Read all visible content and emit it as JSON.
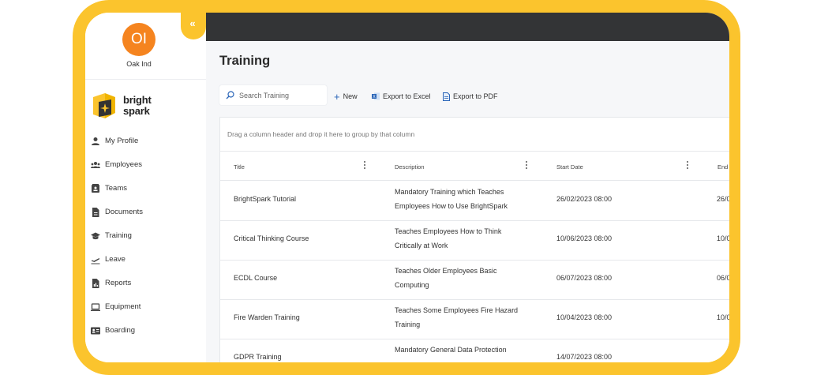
{
  "org": {
    "initials": "OI",
    "name": "Oak Ind"
  },
  "brand": {
    "logo_text": "bright spark"
  },
  "sidebar": {
    "items": [
      {
        "label": "My Profile",
        "icon": "person-icon"
      },
      {
        "label": "Employees",
        "icon": "people-icon"
      },
      {
        "label": "Teams",
        "icon": "contact-card-icon"
      },
      {
        "label": "Documents",
        "icon": "document-icon"
      },
      {
        "label": "Training",
        "icon": "graduation-cap-icon"
      },
      {
        "label": "Leave",
        "icon": "plane-departure-icon"
      },
      {
        "label": "Reports",
        "icon": "report-icon"
      },
      {
        "label": "Equipment",
        "icon": "laptop-icon"
      },
      {
        "label": "Boarding",
        "icon": "id-badge-icon"
      }
    ],
    "collapse_glyph": "«"
  },
  "page": {
    "title": "Training"
  },
  "toolbar": {
    "search_placeholder": "Search Training",
    "new_label": "New",
    "export_excel_label": "Export to Excel",
    "export_pdf_label": "Export to PDF"
  },
  "grid": {
    "group_hint": "Drag a column header and drop it here to group by that column",
    "columns": [
      "Title",
      "Description",
      "Start Date",
      "End"
    ],
    "rows": [
      {
        "title": "BrightSpark Tutorial",
        "desc1": "Mandatory Training which Teaches",
        "desc2": "Employees How to Use BrightSpark",
        "start": "26/02/2023 08:00",
        "end": "26/0"
      },
      {
        "title": "Critical Thinking Course",
        "desc1": "Teaches Employees How to Think",
        "desc2": "Critically at Work",
        "start": "10/06/2023 08:00",
        "end": "10/0"
      },
      {
        "title": "ECDL Course",
        "desc1": "Teaches Older Employees Basic",
        "desc2": "Computing",
        "start": "06/07/2023 08:00",
        "end": "06/0"
      },
      {
        "title": "Fire Warden Training",
        "desc1": "Teaches Some Employees Fire Hazard",
        "desc2": "Training",
        "start": "10/04/2023 08:00",
        "end": "10/0"
      },
      {
        "title": "GDPR Training",
        "desc1": "Mandatory General Data Protection",
        "desc2": "",
        "start": "14/07/2023 08:00",
        "end": ""
      }
    ]
  },
  "colors": {
    "frame": "#FBC42D",
    "avatar": "#F5841F",
    "topbar": "#333436",
    "accent_blue": "#2B66B8"
  }
}
